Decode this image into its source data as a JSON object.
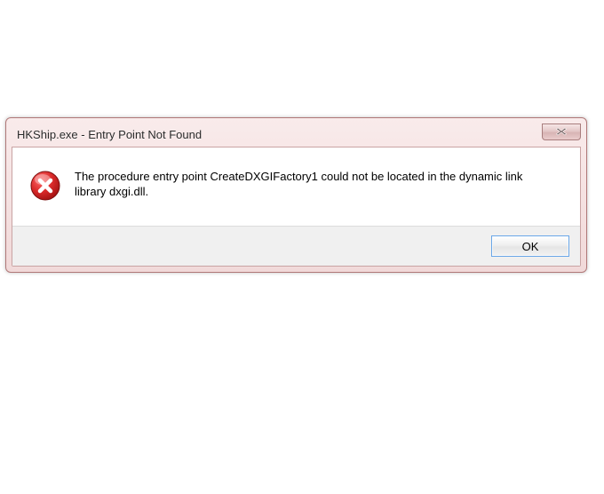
{
  "dialog": {
    "title": "HKShip.exe - Entry Point Not Found",
    "message": "The procedure entry point CreateDXGIFactory1 could not be located in the dynamic link library dxgi.dll.",
    "ok_label": "OK",
    "icon": "error-icon",
    "close_icon": "close-icon"
  }
}
